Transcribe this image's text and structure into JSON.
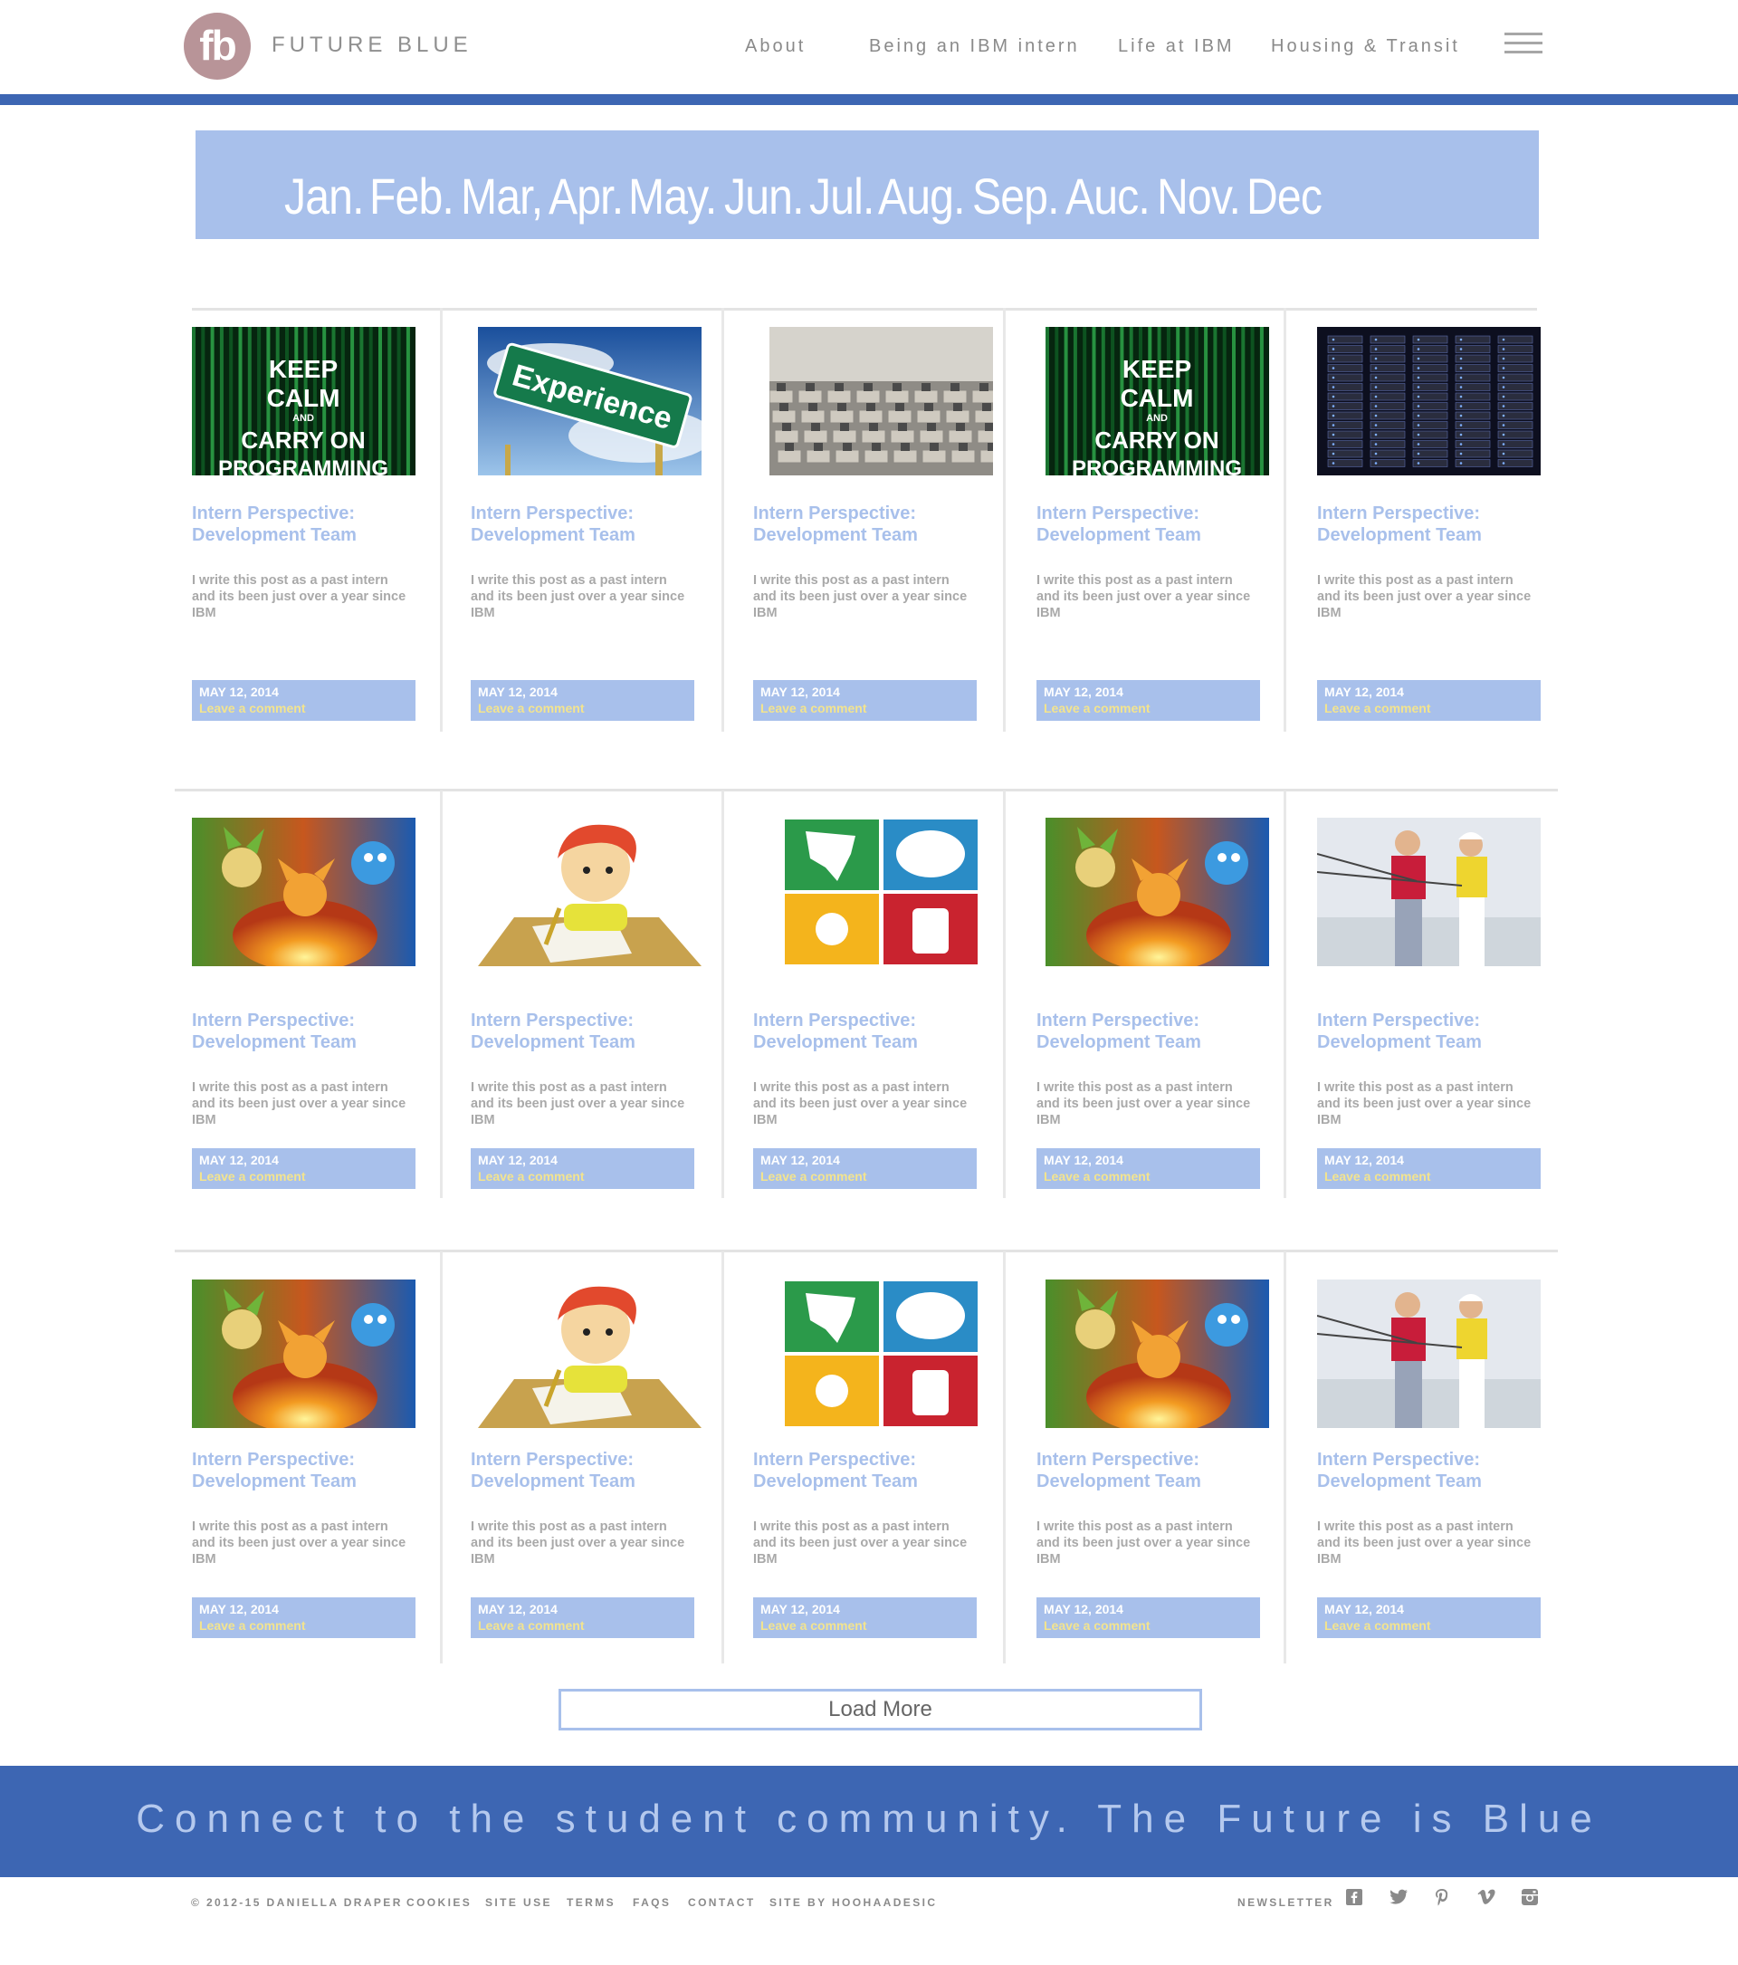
{
  "header": {
    "logo_text": "fb",
    "brand": "FUTURE BLUE",
    "nav": [
      "About",
      "Being an IBM intern",
      "Life at IBM",
      "Housing & Transit"
    ],
    "accent_color": "#3d66b3"
  },
  "months": [
    "Jan.",
    "Feb.",
    "Mar,",
    "Apr.",
    "May.",
    "Jun.",
    "Jul.",
    "Aug.",
    "Sep.",
    "Auc.",
    "Nov.",
    "Dec"
  ],
  "cards": [
    {
      "image": "keep-calm-programming",
      "title": "Intern Perspective: Development Team",
      "excerpt": "I write this post as a past intern and its been just over a year since IBM",
      "date": "MAY 12, 2014",
      "comment": "Leave a comment"
    },
    {
      "image": "experience-sign",
      "title": "Intern Perspective: Development Team",
      "excerpt": "I write this post as a past intern and its been just over a year since IBM",
      "date": "MAY 12, 2014",
      "comment": "Leave a comment"
    },
    {
      "image": "office-cubicles",
      "title": "Intern Perspective: Development Team",
      "excerpt": "I write this post as a past intern and its been just over a year since IBM",
      "date": "MAY 12, 2014",
      "comment": "Leave a comment"
    },
    {
      "image": "keep-calm-programming",
      "title": "Intern Perspective: Development Team",
      "excerpt": "I write this post as a past intern and its been just over a year since IBM",
      "date": "MAY 12, 2014",
      "comment": "Leave a comment"
    },
    {
      "image": "server-racks",
      "title": "Intern Perspective: Development Team",
      "excerpt": "I write this post as a past intern and its been just over a year since IBM",
      "date": "MAY 12, 2014",
      "comment": "Leave a comment"
    },
    {
      "image": "pokemon-starters",
      "title": "Intern Perspective: Development Team",
      "excerpt": "I write this post as a past intern and its been just over a year since IBM",
      "date": "MAY 12, 2014",
      "comment": "Leave a comment"
    },
    {
      "image": "cartoon-girl-writing",
      "title": "Intern Perspective: Development Team",
      "excerpt": "I write this post as a past intern and its been just over a year since IBM",
      "date": "MAY 12, 2014",
      "comment": "Leave a comment"
    },
    {
      "image": "four-color-tiles",
      "title": "Intern Perspective: Development Team",
      "excerpt": "I write this post as a past intern and its been just over a year since IBM",
      "date": "MAY 12, 2014",
      "comment": "Leave a comment"
    },
    {
      "image": "pokemon-starters",
      "title": "Intern Perspective: Development Team",
      "excerpt": "I write this post as a past intern and its been just over a year since IBM",
      "date": "MAY 12, 2014",
      "comment": "Leave a comment"
    },
    {
      "image": "couple-fishing",
      "title": "Intern Perspective: Development Team",
      "excerpt": "I write this post as a past intern and its been just over a year since IBM",
      "date": "MAY 12, 2014",
      "comment": "Leave a comment"
    },
    {
      "image": "pokemon-starters",
      "title": "Intern Perspective: Development Team",
      "excerpt": "I write this post as a past intern and its been just over a year since IBM",
      "date": "MAY 12, 2014",
      "comment": "Leave a comment"
    },
    {
      "image": "cartoon-girl-writing",
      "title": "Intern Perspective: Development Team",
      "excerpt": "I write this post as a past intern and its been just over a year since IBM",
      "date": "MAY 12, 2014",
      "comment": "Leave a comment"
    },
    {
      "image": "four-color-tiles",
      "title": "Intern Perspective: Development Team",
      "excerpt": "I write this post as a past intern and its been just over a year since IBM",
      "date": "MAY 12, 2014",
      "comment": "Leave a comment"
    },
    {
      "image": "pokemon-starters",
      "title": "Intern Perspective: Development Team",
      "excerpt": "I write this post as a past intern and its been just over a year since IBM",
      "date": "MAY 12, 2014",
      "comment": "Leave a comment"
    },
    {
      "image": "couple-fishing",
      "title": "Intern Perspective: Development Team",
      "excerpt": "I write this post as a past intern and its been just over a year since IBM",
      "date": "MAY 12, 2014",
      "comment": "Leave a comment"
    }
  ],
  "load_more": "Load More",
  "footer": {
    "slogan": "Connect to the student community. The Future is Blue",
    "links": [
      "© 2012-15 DANIELLA DRAPER",
      "COOKIES",
      "SITE USE",
      "TERMS",
      "FAQS",
      "CONTACT",
      "SITE BY HOOHAADESIC"
    ],
    "newsletter": "NEWSLETTER",
    "social": [
      "facebook-icon",
      "twitter-icon",
      "pinterest-icon",
      "vimeo-icon",
      "instagram-icon"
    ]
  }
}
